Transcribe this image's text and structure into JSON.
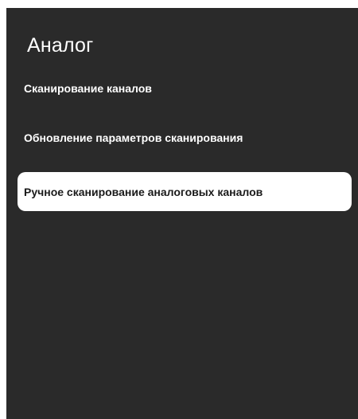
{
  "screen": {
    "title": "Аналог"
  },
  "menu": {
    "selected_index": 2,
    "items": [
      {
        "label": "Сканирование каналов"
      },
      {
        "label": "Обновление параметров сканирования"
      },
      {
        "label": "Ручное сканирование аналоговых каналов"
      }
    ]
  },
  "colors": {
    "background": "#2a2a2a",
    "text": "#ffffff",
    "highlight": "#ffffff",
    "highlight_text": "#1a1a1a"
  }
}
